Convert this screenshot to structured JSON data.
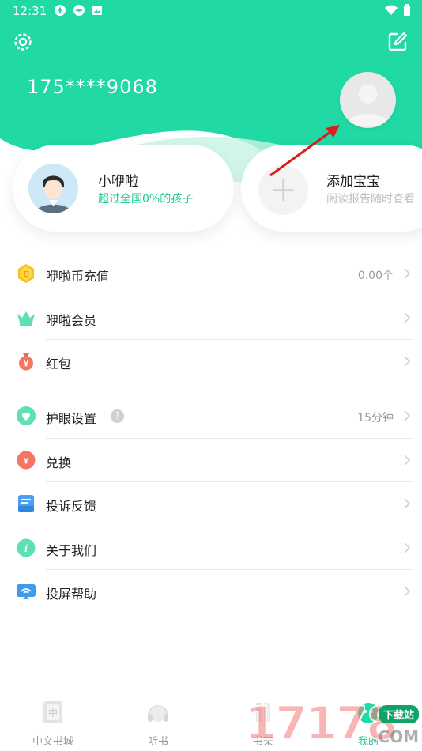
{
  "status_bar": {
    "time": "12:31"
  },
  "profile": {
    "phone": "175****9068"
  },
  "kid_card": {
    "name": "小咿啦",
    "subtitle": "超过全国0%的孩子"
  },
  "add_card": {
    "title": "添加宝宝",
    "subtitle": "阅读报告随时查看"
  },
  "menu_group_1": [
    {
      "label": "咿啦币充值",
      "value": "0.00个"
    },
    {
      "label": "咿啦会员",
      "value": ""
    },
    {
      "label": "红包",
      "value": ""
    }
  ],
  "menu_group_2": [
    {
      "label": "护眼设置",
      "value": "15分钟"
    },
    {
      "label": "兑换",
      "value": ""
    },
    {
      "label": "投诉反馈",
      "value": ""
    },
    {
      "label": "关于我们",
      "value": ""
    },
    {
      "label": "投屏帮助",
      "value": ""
    }
  ],
  "bottom_nav": [
    {
      "label": "中文书城"
    },
    {
      "label": "听书"
    },
    {
      "label": "书架"
    },
    {
      "label": "我的"
    }
  ],
  "watermark": {
    "text": "17178",
    "suffix": ".COM",
    "badge": "下载站"
  },
  "colors": {
    "brand_green": "#20d9a4",
    "accent_text": "#1fc897",
    "arrow_red": "#d81e1e"
  },
  "icons": {
    "top_left": "gear-icon",
    "top_right": "edit-icon",
    "menu_group_1": [
      "coin-icon",
      "crown-icon",
      "red-packet-icon"
    ],
    "menu_group_2": [
      "eye-care-icon",
      "exchange-icon",
      "feedback-icon",
      "info-icon",
      "screen-cast-icon"
    ],
    "bottom_nav": [
      "book-city-icon",
      "headphones-icon",
      "bookshelf-icon",
      "profile-icon"
    ]
  }
}
